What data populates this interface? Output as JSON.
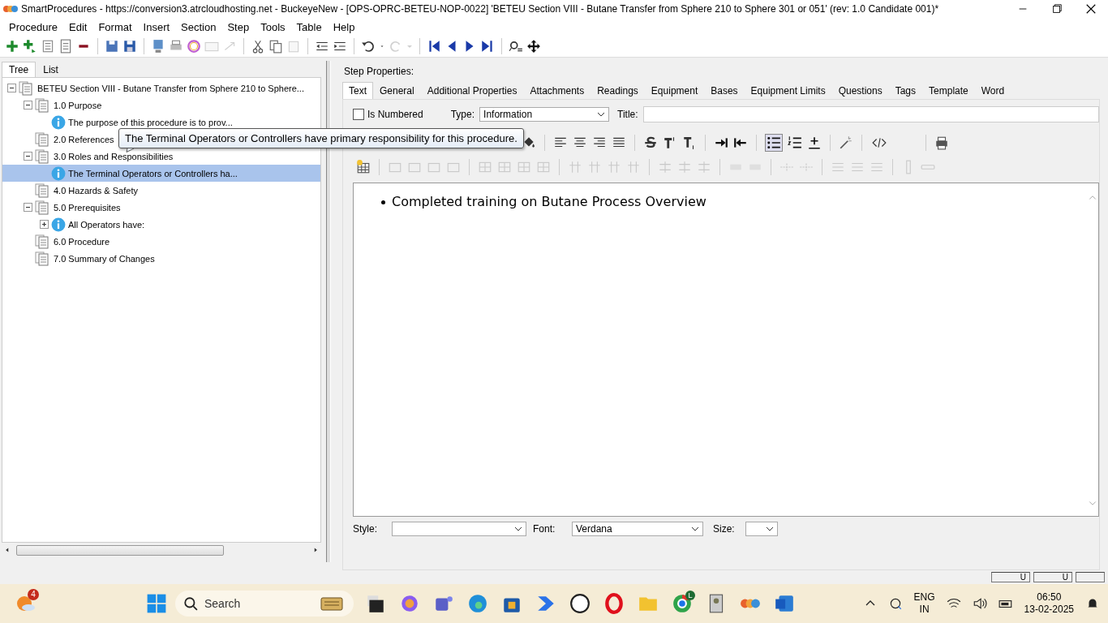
{
  "window": {
    "title": "SmartProcedures - https://conversion3.atrcloudhosting.net - BuckeyeNew - [OPS-OPRC-BETEU-NOP-0022] 'BETEU Section VIII - Butane Transfer from Sphere 210 to Sphere 301 or 051' (rev: 1.0 Candidate 001)*"
  },
  "menu": [
    "Procedure",
    "Edit",
    "Format",
    "Insert",
    "Section",
    "Step",
    "Tools",
    "Table",
    "Help"
  ],
  "left_tabs": [
    {
      "label": "Tree",
      "selected": true
    },
    {
      "label": "List",
      "selected": false
    }
  ],
  "tree": [
    {
      "label": "BETEU Section VIII - Butane Transfer from Sphere 210 to Sphere...",
      "kind": "section",
      "expanded": true,
      "selected": false,
      "children": [
        {
          "label": "1.0 Purpose",
          "kind": "section",
          "expanded": true,
          "selected": false,
          "children": [
            {
              "label": "The purpose of this procedure is to prov...",
              "kind": "info",
              "selected": false
            }
          ]
        },
        {
          "label": "2.0 References",
          "kind": "section",
          "selected": false
        },
        {
          "label": "3.0 Roles and Responsibilities",
          "kind": "section",
          "expanded": true,
          "selected": false,
          "children": [
            {
              "label": "The Terminal Operators or Controllers ha...",
              "kind": "info",
              "selected": true
            }
          ]
        },
        {
          "label": "4.0 Hazards & Safety",
          "kind": "section",
          "selected": false
        },
        {
          "label": "5.0 Prerequisites",
          "kind": "section",
          "expanded": true,
          "selected": false,
          "children": [
            {
              "label": "All Operators have:",
              "kind": "info",
              "expanded": false,
              "selected": false
            }
          ]
        },
        {
          "label": "6.0 Procedure",
          "kind": "section",
          "selected": false
        },
        {
          "label": "7.0 Summary of Changes",
          "kind": "section",
          "selected": false
        }
      ]
    }
  ],
  "tooltip": "The Terminal Operators or Controllers have primary responsibility for this procedure.",
  "step_properties": {
    "heading": "Step Properties:",
    "tabs": [
      {
        "label": "Text",
        "selected": true
      },
      {
        "label": "General",
        "selected": false
      },
      {
        "label": "Additional Properties",
        "selected": false
      },
      {
        "label": "Attachments",
        "selected": false
      },
      {
        "label": "Readings",
        "selected": false
      },
      {
        "label": "Equipment",
        "selected": false
      },
      {
        "label": "Bases",
        "selected": false
      },
      {
        "label": "Equipment Limits",
        "selected": false
      },
      {
        "label": "Questions",
        "selected": false
      },
      {
        "label": "Tags",
        "selected": false
      },
      {
        "label": "Template",
        "selected": false
      },
      {
        "label": "Word",
        "selected": false
      }
    ],
    "is_numbered": {
      "label": "Is Numbered",
      "checked": false
    },
    "type": {
      "label": "Type:",
      "value": "Information"
    },
    "title": {
      "label": "Title:"
    },
    "editor_bullets": [
      "Completed training on Butane Process Overview"
    ],
    "style": {
      "label": "Style:"
    },
    "font": {
      "label": "Font:",
      "value": "Verdana"
    },
    "size": {
      "label": "Size:"
    }
  },
  "status_bar": [
    "U",
    "U"
  ],
  "taskbar": {
    "weather_badge": "4",
    "search_placeholder": "Search",
    "chrome_badge": "L",
    "language": "ENG",
    "region": "IN",
    "time": "06:50",
    "date": "13-02-2025"
  }
}
